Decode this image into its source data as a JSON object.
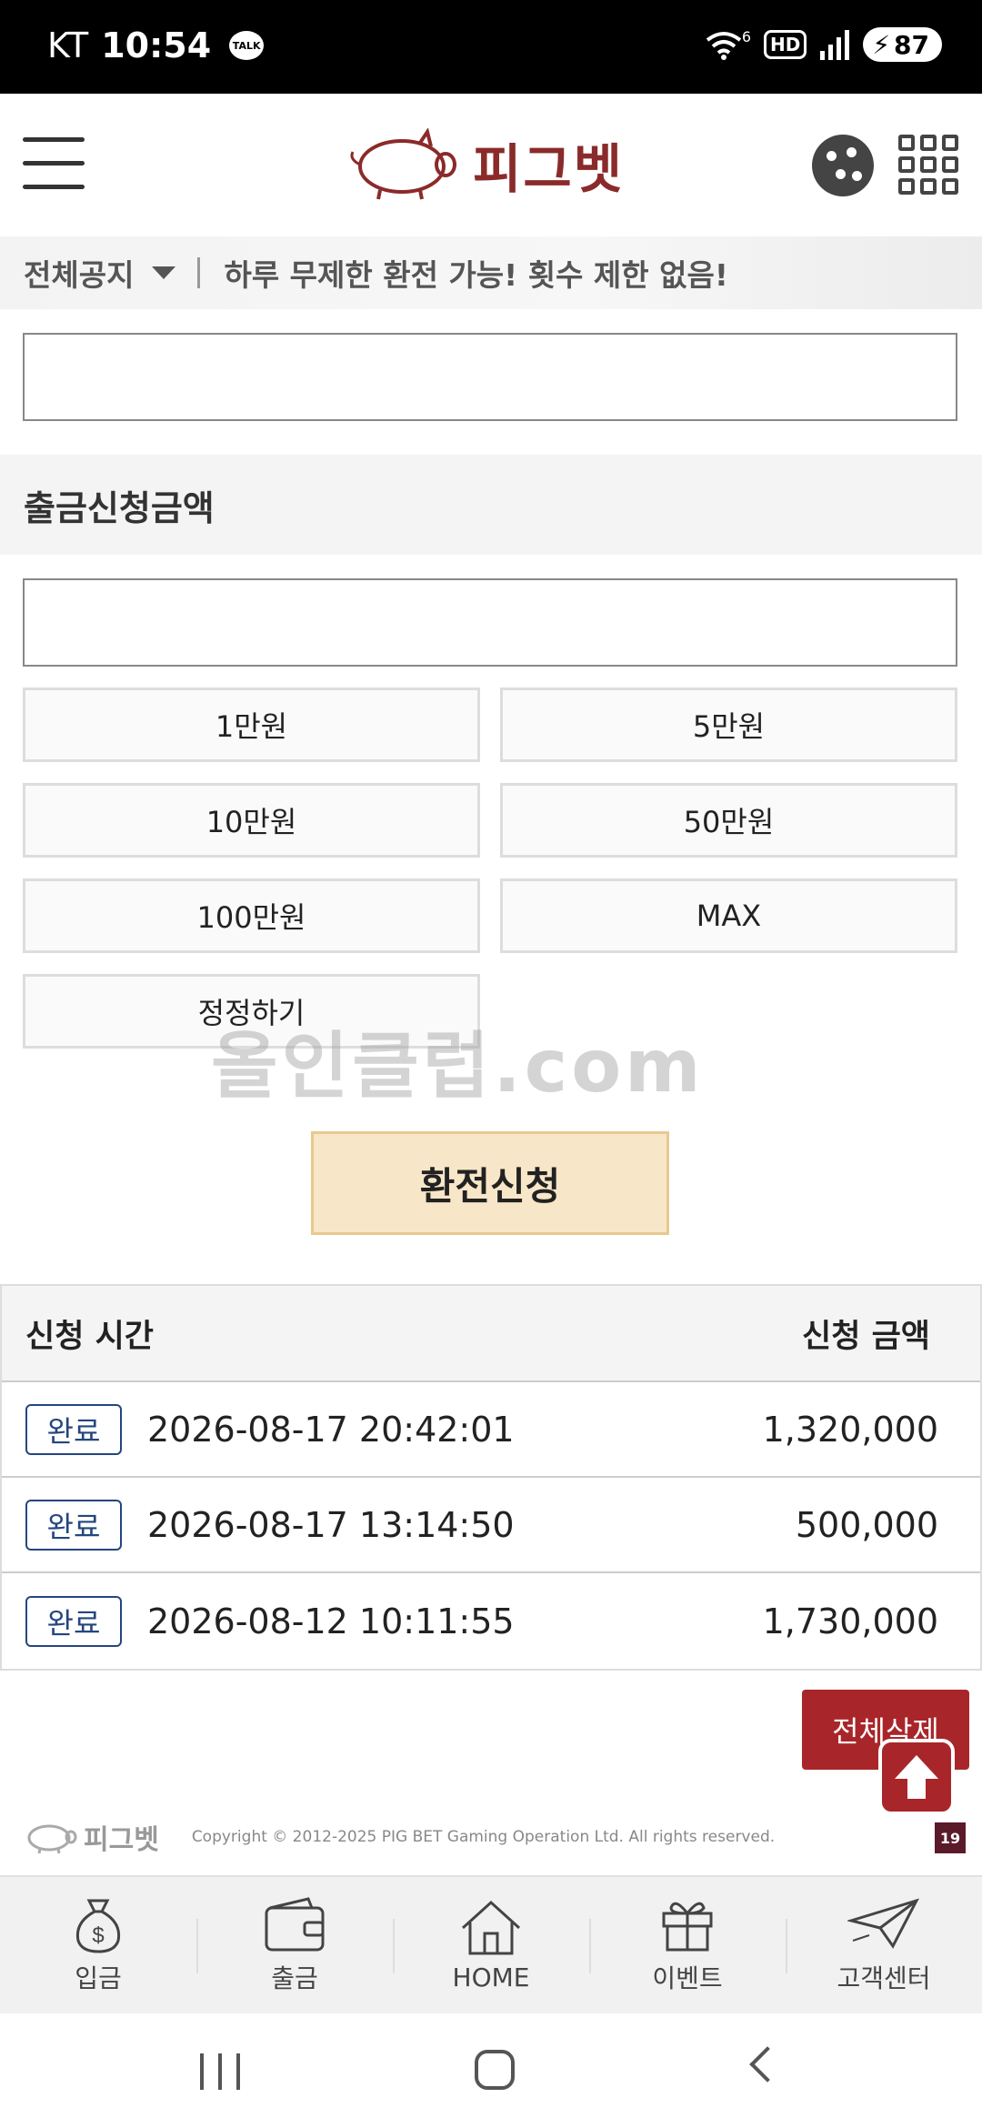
{
  "status_bar": {
    "carrier": "KT",
    "time": "10:54",
    "talk_label": "TALK",
    "hd_label": "HD",
    "wifi_sup": "6",
    "battery": "87"
  },
  "header": {
    "logo_text": "피그벳",
    "icons": [
      "menu-icon",
      "cookie-icon",
      "grid-menu-icon"
    ]
  },
  "notice": {
    "label": "전체공지",
    "text": "하루 무제한 환전 가능! 횟수 제한 없음!"
  },
  "withdraw": {
    "section_title": "출금신청금액",
    "amount_buttons": [
      "1만원",
      "5만원",
      "10만원",
      "50만원",
      "100만원",
      "MAX"
    ],
    "reset_label": "정정하기",
    "submit_label": "환전신청"
  },
  "watermark": "올인클럽.com",
  "history": {
    "headers": {
      "time": "신청 시간",
      "amount": "신청 금액"
    },
    "rows": [
      {
        "status": "완료",
        "time": "2026-08-17 20:42:01",
        "amount": "1,320,000"
      },
      {
        "status": "완료",
        "time": "2026-08-17 13:14:50",
        "amount": "500,000"
      },
      {
        "status": "완료",
        "time": "2026-08-12 10:11:55",
        "amount": "1,730,000"
      }
    ],
    "delete_all_label": "전체삭제"
  },
  "footer": {
    "logo_text": "피그벳",
    "copyright": "Copyright © 2012-2025 PIG BET Gaming Operation Ltd. All rights reserved.",
    "age_badge": "19"
  },
  "bottom_nav": [
    {
      "label": "입금",
      "icon": "money-bag-icon"
    },
    {
      "label": "출금",
      "icon": "wallet-icon"
    },
    {
      "label": "HOME",
      "icon": "home-icon"
    },
    {
      "label": "이벤트",
      "icon": "gift-icon"
    },
    {
      "label": "고객센터",
      "icon": "paper-plane-icon"
    }
  ],
  "colors": {
    "brand": "#8b2a2a",
    "delete_button": "#a8262a",
    "submit_bg": "#f8e6c8",
    "status_badge": "#24467e"
  }
}
